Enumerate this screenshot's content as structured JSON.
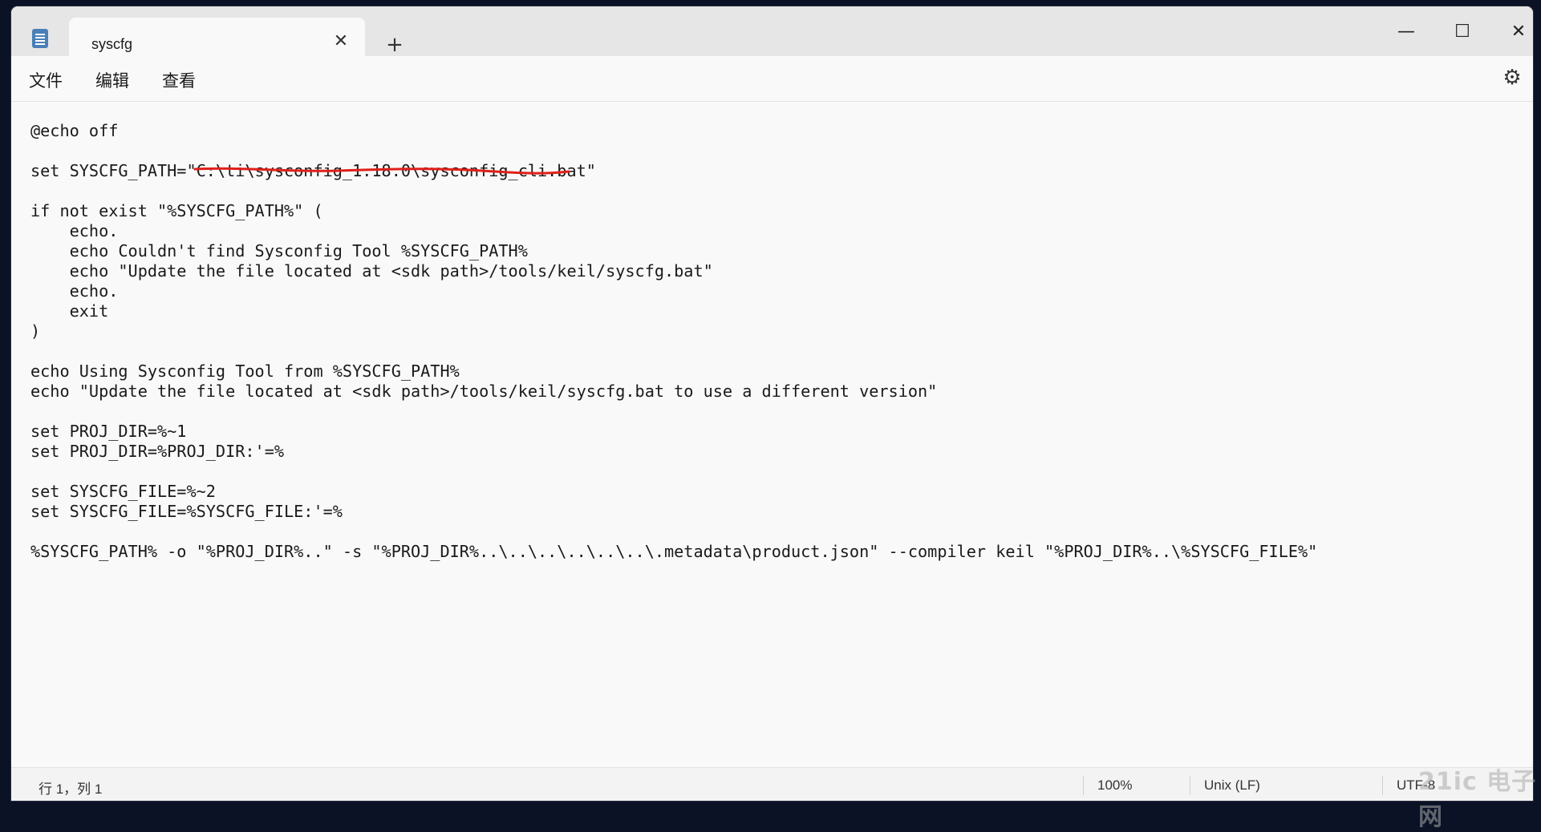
{
  "window": {
    "tab_title": "syscfg",
    "tab_close_glyph": "✕",
    "new_tab_glyph": "+",
    "minimize_glyph": "—",
    "maximize_glyph": "☐",
    "close_glyph": "✕"
  },
  "menu": {
    "file": "文件",
    "edit": "编辑",
    "view": "查看",
    "settings_glyph": "⚙"
  },
  "editor": {
    "lines": [
      "@echo off",
      "",
      "set SYSCFG_PATH=\"C:\\ti\\sysconfig_1.18.0\\sysconfig_cli.bat\"",
      "",
      "if not exist \"%SYSCFG_PATH%\" (",
      "    echo.",
      "    echo Couldn't find Sysconfig Tool %SYSCFG_PATH%",
      "    echo \"Update the file located at <sdk path>/tools/keil/syscfg.bat\"",
      "    echo.",
      "    exit",
      ")",
      "",
      "echo Using Sysconfig Tool from %SYSCFG_PATH%",
      "echo \"Update the file located at <sdk path>/tools/keil/syscfg.bat to use a different version\"",
      "",
      "set PROJ_DIR=%~1",
      "set PROJ_DIR=%PROJ_DIR:'=%",
      "",
      "set SYSCFG_FILE=%~2",
      "set SYSCFG_FILE=%SYSCFG_FILE:'=%",
      "",
      "%SYSCFG_PATH% -o \"%PROJ_DIR%..\" -s \"%PROJ_DIR%..\\..\\..\\..\\..\\..\\.metadata\\product.json\" --compiler keil \"%PROJ_DIR%..\\%SYSCFG_FILE%\""
    ],
    "annotation_color": "#e0201a"
  },
  "status": {
    "position": "行 1，列 1",
    "zoom": "100%",
    "line_ending": "Unix (LF)",
    "encoding": "UTF-8"
  },
  "watermark": "21ic 电子网"
}
